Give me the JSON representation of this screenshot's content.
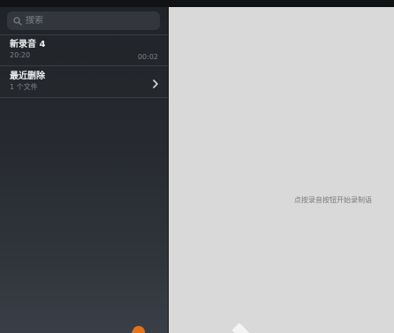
{
  "search": {
    "placeholder": "搜索"
  },
  "recordings": [
    {
      "title": "新录音 4",
      "time": "20:20",
      "duration": "00:02"
    }
  ],
  "recently_deleted": {
    "title": "最近删除",
    "subtitle": "1 个文件"
  },
  "main": {
    "empty_hint": "点按录音按钮开始录制语"
  },
  "colors": {
    "sidebar_bg": "#262a30",
    "detail_bg": "#d9d9d9",
    "record_accent": "#e0731e"
  },
  "icons": [
    "search-icon",
    "chevron-right-icon"
  ]
}
